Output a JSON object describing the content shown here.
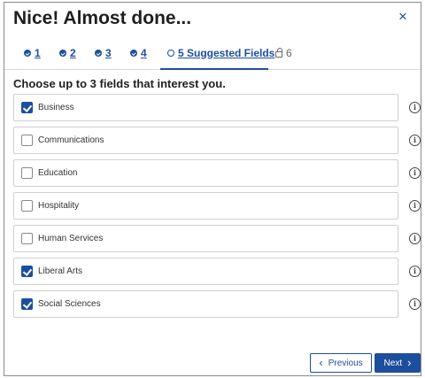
{
  "dialog": {
    "title": "Nice! Almost done...",
    "close_icon": "×"
  },
  "stepper": {
    "steps": [
      {
        "label": "1",
        "state": "complete"
      },
      {
        "label": "2",
        "state": "complete"
      },
      {
        "label": "3",
        "state": "complete"
      },
      {
        "label": "4",
        "state": "complete"
      },
      {
        "label": "5 Suggested Fields",
        "state": "current"
      },
      {
        "label": "6",
        "state": "locked"
      }
    ]
  },
  "prompt": "Choose up to 3 fields that interest you.",
  "options": [
    {
      "label": "Business",
      "checked": true
    },
    {
      "label": "Communications",
      "checked": false
    },
    {
      "label": "Education",
      "checked": false
    },
    {
      "label": "Hospitality",
      "checked": false
    },
    {
      "label": "Human Services",
      "checked": false
    },
    {
      "label": "Liberal Arts",
      "checked": true
    },
    {
      "label": "Social Sciences",
      "checked": true
    }
  ],
  "info_icon": "i",
  "footer": {
    "previous_label": "Previous",
    "next_label": "Next",
    "prev_chevron": "‹",
    "next_chevron": "›"
  },
  "colors": {
    "accent": "#1d4e9e"
  }
}
